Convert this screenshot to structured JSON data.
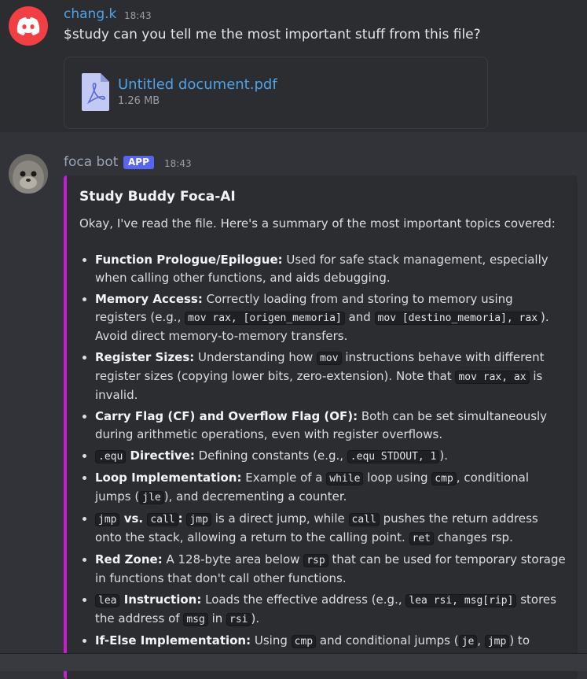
{
  "message1": {
    "username": "chang.k",
    "time": "18:43",
    "text": "$study can you tell me the most important stuff from this file?",
    "attachment": {
      "name": "Untitled document.pdf",
      "size": "1.26 MB",
      "icon": "pdf-file-icon"
    }
  },
  "message2": {
    "username": "foca bot",
    "badge": "APP",
    "time": "18:43",
    "embed": {
      "title": "Study Buddy Foca-AI",
      "intro": "Okay, I've read the file. Here's a summary of the most important topics covered:",
      "items": [
        {
          "h": "Function Prologue/Epilogue:",
          "t1": " Used for safe stack management, especially when calling other functions, and aids debugging."
        },
        {
          "h": "Memory Access:",
          "t1": "  Correctly loading from and storing to memory using registers (e.g., ",
          "c1": "mov rax, [origen_memoria]",
          "t2": " and ",
          "c2": "mov [destino_memoria], rax",
          "t3": "). Avoid direct memory-to-memory transfers."
        },
        {
          "h": "Register Sizes:",
          "t1": " Understanding how ",
          "c1": "mov",
          "t2": " instructions behave with different register sizes (copying lower bits, zero-extension).  Note that ",
          "c2": "mov rax, ax",
          "t3": " is invalid."
        },
        {
          "h": "Carry Flag (CF) and Overflow Flag (OF):",
          "t1": "  Both can be set simultaneously during arithmetic operations, even with register overflows."
        },
        {
          "hc": ".equ",
          "h": " Directive:",
          "t1": " Defining constants (e.g., ",
          "c1": ".equ STDOUT, 1",
          "t2": ")."
        },
        {
          "h": "Loop Implementation:",
          "t1": "  Example of a ",
          "c1": "while",
          "t2": " loop using ",
          "c2": "cmp",
          "t3": ", conditional jumps (",
          "c3": "jle",
          "t4": "), and decrementing a counter."
        },
        {
          "hc": "jmp",
          "h": " vs. ",
          "hc2": "call",
          "h2": ":",
          "t1": " ",
          "c1": "jmp",
          "t2": " is a direct jump, while ",
          "c2": "call",
          "t3": " pushes the return address onto the stack, allowing a return to the calling point. ",
          "c3": "ret",
          "t4": " changes rsp."
        },
        {
          "h": "Red Zone:",
          "t1": " A 128-byte area below ",
          "c1": "rsp",
          "t2": " that can be used for temporary storage in functions that don't call other functions."
        },
        {
          "hc": "lea",
          "h": " Instruction:",
          "t1": "  Loads the effective address (e.g., ",
          "c1": "lea rsi, msg[rip]",
          "t2": " stores the address of ",
          "c2": "msg",
          "t3": " in ",
          "c3": "rsi",
          "t4": ")."
        },
        {
          "h": "If-Else Implementation:",
          "t1": "  Using ",
          "c1": "cmp",
          "t2": " and conditional jumps (",
          "c2": "je",
          "t3": ", ",
          "c3": "jmp",
          "t4": ") to"
        }
      ]
    }
  },
  "colors": {
    "accent": "#c51cd4",
    "link": "#4ea3e8",
    "badge": "#5865f2"
  }
}
